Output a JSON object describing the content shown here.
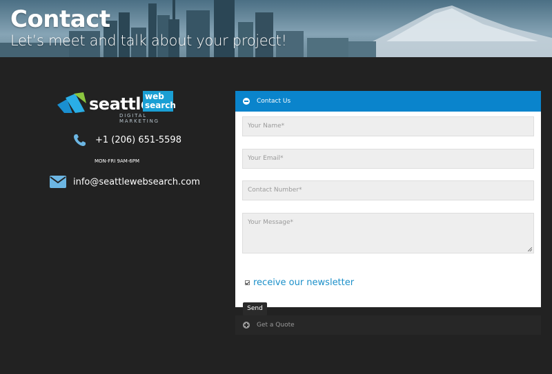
{
  "hero": {
    "title": "Contact",
    "subtitle": "Let’s meet and talk about your project!"
  },
  "logo": {
    "word": "seattle",
    "box_line1": "web",
    "box_line2": "search",
    "tagline": "DIGITAL MARKETING"
  },
  "contact_info": {
    "phone": "+1 (206) 651-5598",
    "hours": "MON-FRI 9AM-6PM",
    "email": "info@seattlewebsearch.com"
  },
  "form": {
    "header_label": "Contact Us",
    "name_placeholder": "Your Name*",
    "email_placeholder": "Your Email*",
    "number_placeholder": "Contact Number*",
    "message_placeholder": "Your Message*",
    "newsletter_label": "receive our newsletter",
    "newsletter_checked": true,
    "send_label": "Send"
  },
  "quote": {
    "header_label": "Get a Quote"
  },
  "colors": {
    "accent": "#0a84cc",
    "background": "#222222",
    "link": "#1a8fc9"
  },
  "icons": {
    "phone": "phone-icon",
    "email": "envelope-icon",
    "collapse": "circle-minus-icon",
    "expand": "circle-plus-icon"
  }
}
